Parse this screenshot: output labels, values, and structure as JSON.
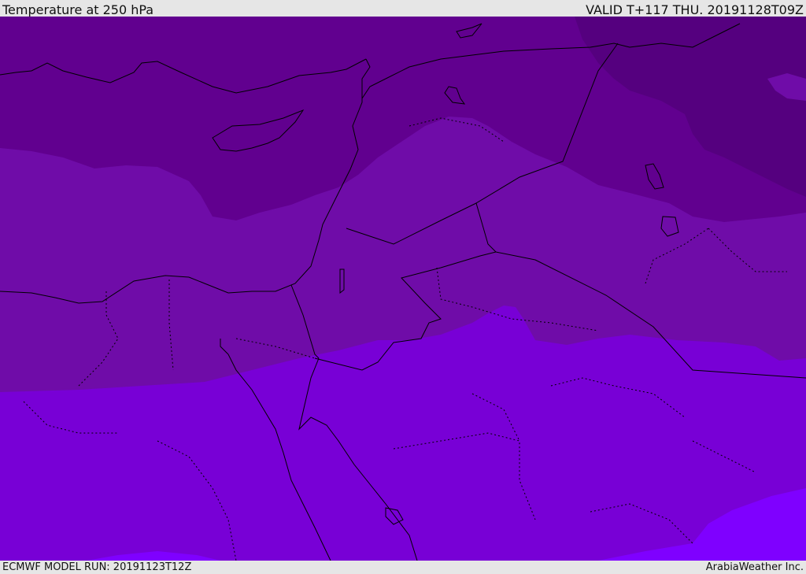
{
  "header": {
    "title": "Temperature at 250 hPa",
    "valid_time": "VALID T+117 THU. 20191128T09Z"
  },
  "footer": {
    "model_run": "ECMWF MODEL RUN: 20191123T12Z",
    "credit": "ArabiaWeather Inc."
  },
  "colors": {
    "band_coldest": "#55007f",
    "band_cold": "#61008f",
    "band_mid": "#6f0ca8",
    "band_warm": "#7800d6",
    "band_warmest": "#7f00ff",
    "coastline": "#000000"
  }
}
